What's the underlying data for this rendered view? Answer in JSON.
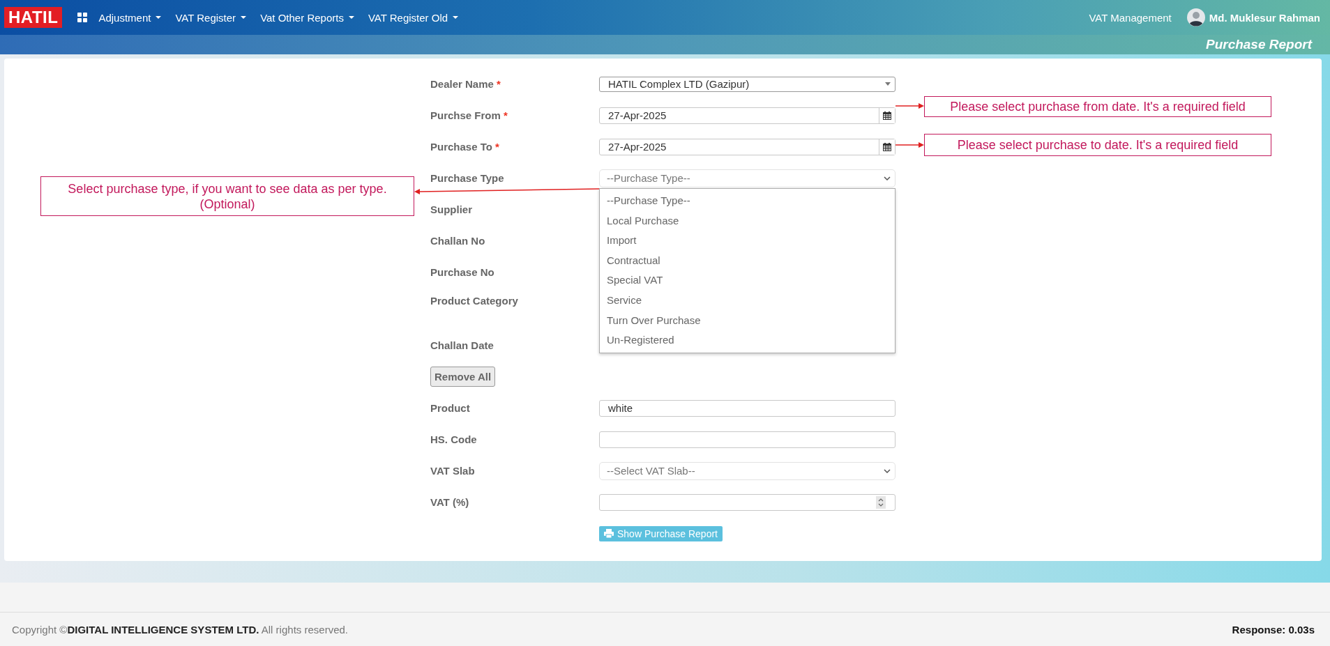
{
  "navbar": {
    "logo": "HATIL",
    "menus": [
      {
        "label": "Adjustment"
      },
      {
        "label": "VAT Register"
      },
      {
        "label": "Vat Other Reports"
      },
      {
        "label": "VAT Register Old"
      }
    ],
    "app_name": "VAT Management",
    "user_name": "Md. Muklesur Rahman"
  },
  "page_title": "Purchase Report",
  "form": {
    "rows": [
      {
        "kind": "select",
        "label": "Dealer Name",
        "marker": "*",
        "value": "HATIL Complex LTD (Gazipur)"
      },
      {
        "kind": "date",
        "label": "Purchse From",
        "marker": "*",
        "value": "27-Apr-2025"
      },
      {
        "kind": "date",
        "label": "Purchase To",
        "marker": "*",
        "value": "27-Apr-2025"
      },
      {
        "kind": "dropdown",
        "label": "Purchase Type",
        "value": "--Purchase Type--",
        "options": [
          "--Purchase Type--",
          "Local Purchase",
          "Import",
          "Contractual",
          "Special VAT",
          "Service",
          "Turn Over Purchase",
          "Un-Registered"
        ]
      },
      {
        "kind": "covered",
        "label": "Supplier"
      },
      {
        "kind": "covered",
        "label": "Challan No"
      },
      {
        "kind": "covered",
        "label": "Purchase No"
      },
      {
        "kind": "covered_tall",
        "label": "Product Category"
      },
      {
        "kind": "covered",
        "label": "Challan Date"
      },
      {
        "kind": "button",
        "text": "Remove All"
      },
      {
        "kind": "text",
        "label": "Product",
        "value": "white"
      },
      {
        "kind": "text",
        "label": "HS. Code"
      },
      {
        "kind": "select_plain",
        "label": "VAT Slab",
        "value": "--Select VAT Slab--"
      },
      {
        "kind": "number",
        "label": "VAT (%)"
      },
      {
        "kind": "submit",
        "text": "Show Purchase Report"
      }
    ]
  },
  "callouts": [
    {
      "kind": "right",
      "text": "Please select purchase from date. It's a required field"
    },
    {
      "kind": "right",
      "text": "Please select purchase to date. It's a required field"
    },
    {
      "kind": "left",
      "text": "Select purchase type, if you want to see data as per type.\n(Optional)"
    }
  ],
  "footer": {
    "copyright": "Copyright ©**DIGITAL INTELLIGENCE SYSTEM LTD.** All rights reserved.",
    "response": "Response: 0.03s"
  }
}
